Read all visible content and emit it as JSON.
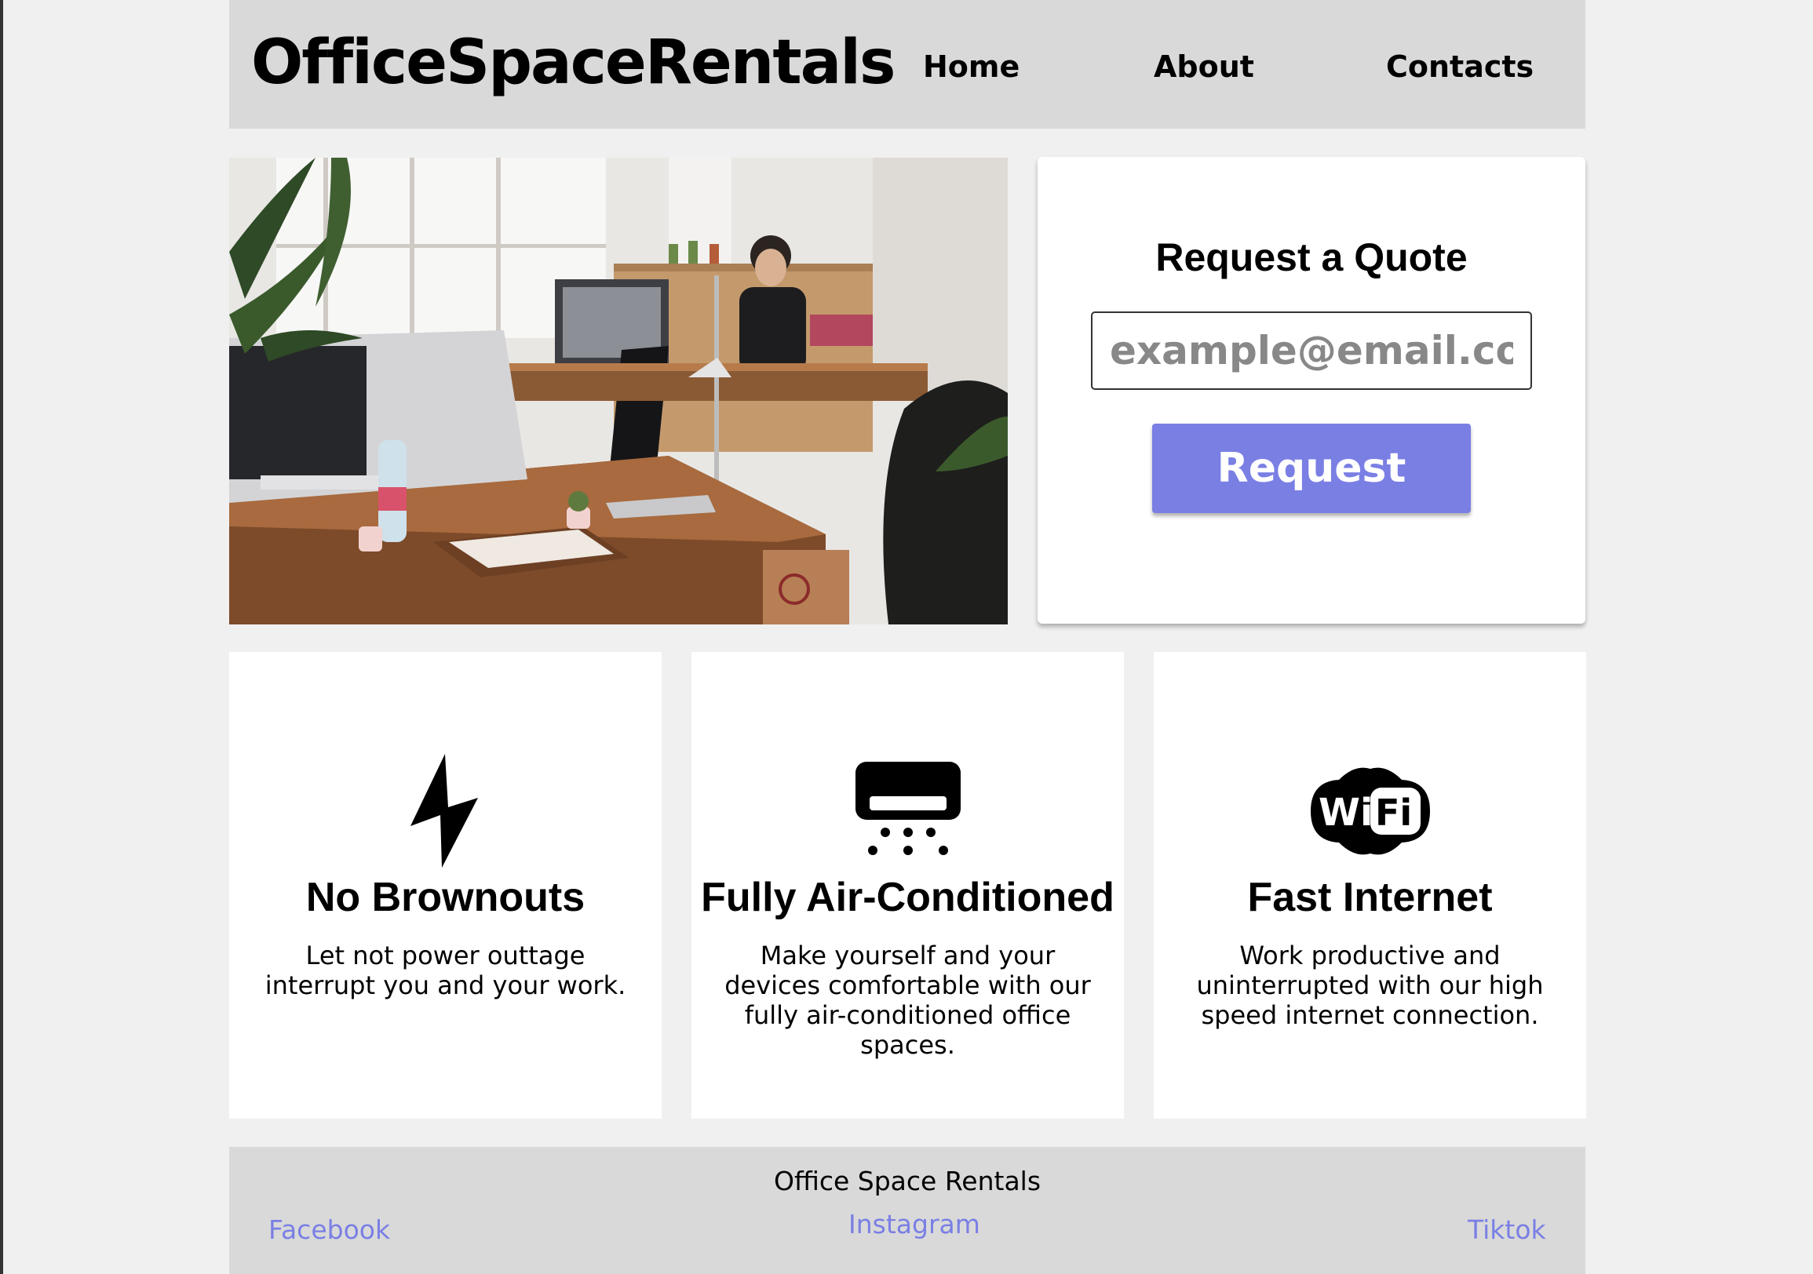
{
  "header": {
    "brand": "OfficeSpaceRentals",
    "nav": {
      "home": "Home",
      "about": "About",
      "contacts": "Contacts"
    }
  },
  "hero": {
    "image_icon": "office-photo"
  },
  "quote": {
    "title": "Request a Quote",
    "email_placeholder": "example@email.com",
    "email_value": "",
    "button_label": "Request"
  },
  "features": [
    {
      "icon": "lightning-icon",
      "title": "No Brownouts",
      "description": "Let not power outtage interrupt you and your work."
    },
    {
      "icon": "air-conditioner-icon",
      "title": "Fully Air-Conditioned",
      "description": "Make yourself and your devices comfortable with our fully air-conditioned office spaces."
    },
    {
      "icon": "wifi-icon",
      "title": "Fast Internet",
      "description": "Work productive and uninterrupted with our high speed internet connection."
    }
  ],
  "footer": {
    "title": "Office Space Rentals",
    "links": {
      "facebook": "Facebook",
      "instagram": "Instagram",
      "tiktok": "Tiktok"
    }
  },
  "colors": {
    "accent": "#7a7fe4",
    "header_bg": "#d9d9d9",
    "page_bg": "#f0f0f0"
  }
}
